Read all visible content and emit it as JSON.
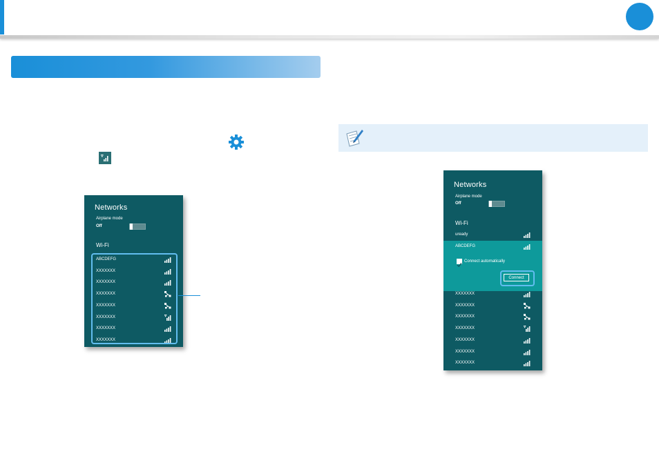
{
  "page": {
    "accent_color": "#1a8fd8",
    "icons": {
      "settings": "gear-icon",
      "network": "network-icon",
      "note": "note-pen-icon"
    }
  },
  "left_panel": {
    "title": "Networks",
    "airplane_label": "Airplane mode",
    "airplane_state": "Off",
    "wifi_title": "Wi-Fi",
    "networks": [
      {
        "name": "ABCDEFG",
        "signal": "bars"
      },
      {
        "name": "XXXXXXX",
        "signal": "bars"
      },
      {
        "name": "XXXXXXX",
        "signal": "bars"
      },
      {
        "name": "XXXXXXX",
        "signal": "shared"
      },
      {
        "name": "XXXXXXX",
        "signal": "shared"
      },
      {
        "name": "XXXXXXX",
        "signal": "secured"
      },
      {
        "name": "XXXXXXX",
        "signal": "bars"
      },
      {
        "name": "XXXXXXX",
        "signal": "bars"
      }
    ]
  },
  "right_panel": {
    "title": "Networks",
    "airplane_label": "Airplane mode",
    "airplane_state": "Off",
    "wifi_title": "Wi-Fi",
    "top_network": "uready",
    "selected_network": "ABCDEFG",
    "connect_auto_label": "Connect automatically",
    "connect_auto_checked": true,
    "connect_label": "Connect",
    "networks": [
      {
        "name": "XXXXXXX",
        "signal": "bars"
      },
      {
        "name": "XXXXXXX",
        "signal": "shared"
      },
      {
        "name": "XXXXXXX",
        "signal": "shared"
      },
      {
        "name": "XXXXXXX",
        "signal": "secured"
      },
      {
        "name": "XXXXXXX",
        "signal": "bars"
      },
      {
        "name": "XXXXXXX",
        "signal": "bars"
      },
      {
        "name": "XXXXXXX",
        "signal": "bars"
      }
    ]
  }
}
